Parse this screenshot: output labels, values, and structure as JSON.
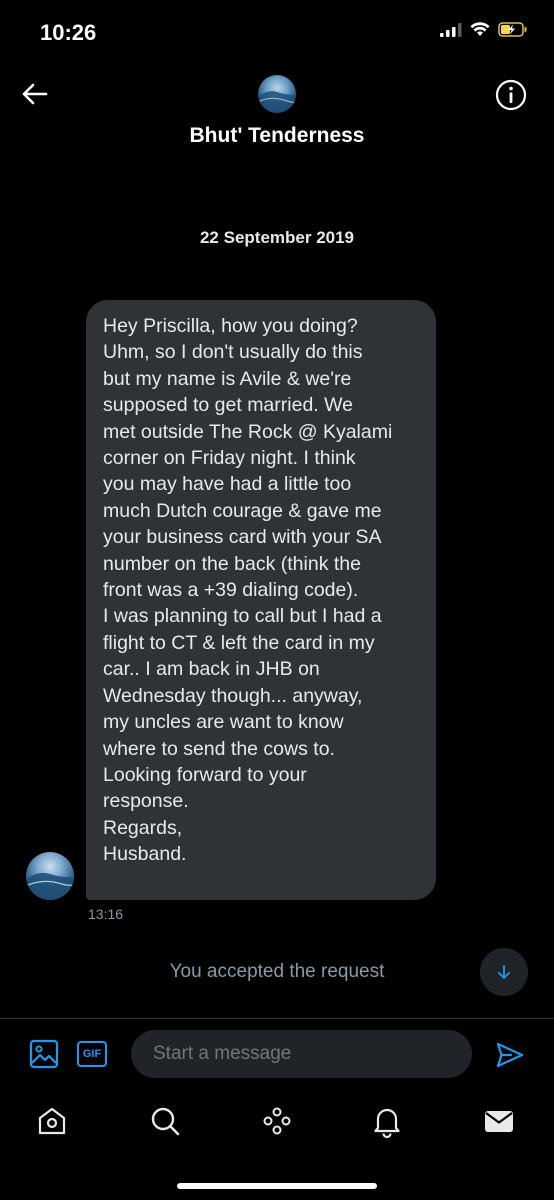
{
  "status_bar": {
    "time": "10:26",
    "icons": [
      "signal-icon",
      "wifi-icon",
      "battery-charging-icon"
    ]
  },
  "header": {
    "title": "Bhut' Tenderness",
    "icons": [
      "back-arrow-icon",
      "info-icon"
    ]
  },
  "conversation": {
    "date": "22 September 2019",
    "message": {
      "lines": [
        "Hey Priscilla, how you doing?",
        "Uhm, so I don't usually do this",
        "but my name is Avile & we're",
        "supposed to get married. We",
        "met outside The Rock @ Kyalami",
        "corner on Friday night. I think",
        "you may have had a little too",
        "much Dutch courage & gave me",
        "your business card with your SA",
        "number on the back (think the",
        "front was a +39 dialing code).",
        "I was planning to call but I had a",
        "flight to CT & left the card in my",
        "car.. I am back in JHB on",
        "Wednesday though... anyway,",
        "my uncles are want to know",
        "where to send the cows to.",
        "Looking forward to your",
        "response.",
        "Regards,",
        "Husband."
      ],
      "time": "13:16"
    },
    "system_notice": "You accepted the request"
  },
  "composer": {
    "placeholder": "Start a message",
    "gif_label": "GIF",
    "icons": [
      "image-icon",
      "gif-icon",
      "send-icon"
    ]
  },
  "bottom_nav": {
    "items": [
      "home-icon",
      "search-icon",
      "spaces-icon",
      "notifications-icon",
      "messages-icon"
    ]
  },
  "colors": {
    "background": "#000000",
    "bubble": "#2f3336",
    "accent": "#1d9bf0",
    "muted_text": "#8b98a5",
    "text": "#e7e9ea"
  }
}
